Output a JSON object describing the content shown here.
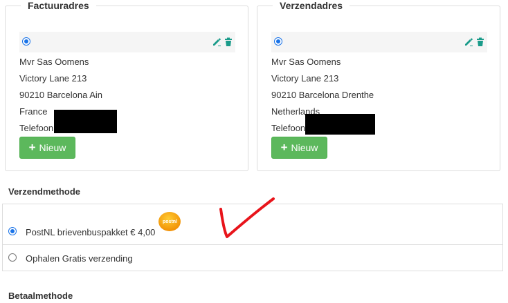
{
  "billing": {
    "legend": "Factuuradres",
    "lines": [
      "Mvr Sas Oomens",
      "Victory Lane 213",
      "90210 Barcelona Ain",
      "France",
      "Telefoon:"
    ],
    "new_button": "Nieuw"
  },
  "shipping_address": {
    "legend": "Verzendadres",
    "lines": [
      "Mvr Sas Oomens",
      "Victory Lane 213",
      "90210 Barcelona Drenthe",
      "Netherlands",
      "Telefoon:"
    ],
    "new_button": "Nieuw"
  },
  "shipping_method": {
    "title": "Verzendmethode",
    "options": [
      {
        "label": "PostNL brievenbuspakket € 4,00",
        "selected": true,
        "logo_text": "postnl"
      },
      {
        "label": "Ophalen Gratis verzending",
        "selected": false
      }
    ]
  },
  "payment_method": {
    "title": "Betaalmethode"
  },
  "colors": {
    "green_button": "#5cb85c",
    "icon_teal": "#1a9b8a",
    "radio_blue": "#1a73e8",
    "annotation_red": "#e8141b",
    "postnl_orange": "#f39c12"
  },
  "icons": [
    "pencil-icon",
    "trash-icon",
    "plus-icon",
    "postnl-logo-icon"
  ]
}
